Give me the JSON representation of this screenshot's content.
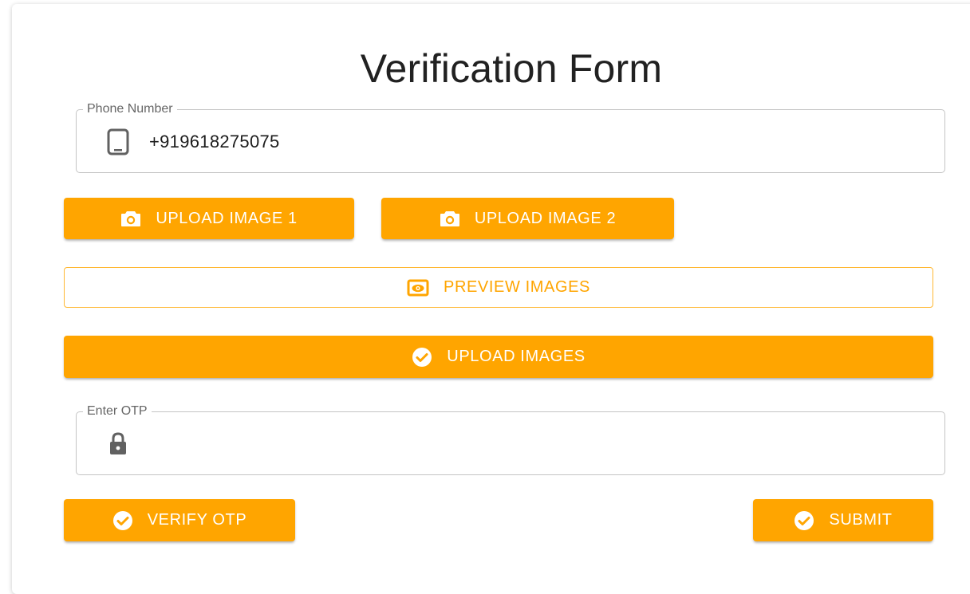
{
  "form": {
    "title": "Verification Form",
    "phone_field": {
      "label": "Phone Number",
      "value": "+919618275075",
      "icon": "smartphone-icon"
    },
    "upload_image_1": {
      "label": "UPLOAD IMAGE 1",
      "icon": "camera-icon"
    },
    "upload_image_2": {
      "label": "UPLOAD IMAGE 2",
      "icon": "camera-icon"
    },
    "preview_images": {
      "label": "PREVIEW IMAGES",
      "icon": "preview-icon"
    },
    "upload_images": {
      "label": "UPLOAD IMAGES",
      "icon": "check-circle-icon"
    },
    "otp_field": {
      "label": "Enter OTP",
      "value": "",
      "icon": "lock-icon"
    },
    "verify_otp": {
      "label": "VERIFY OTP",
      "icon": "check-circle-icon"
    },
    "submit": {
      "label": "SUBMIT",
      "icon": "check-circle-icon"
    }
  },
  "colors": {
    "accent": "#ffa500",
    "accent_text": "#ffffff",
    "field_border": "#c4c4c4",
    "label": "#666666",
    "icon": "#616161"
  }
}
